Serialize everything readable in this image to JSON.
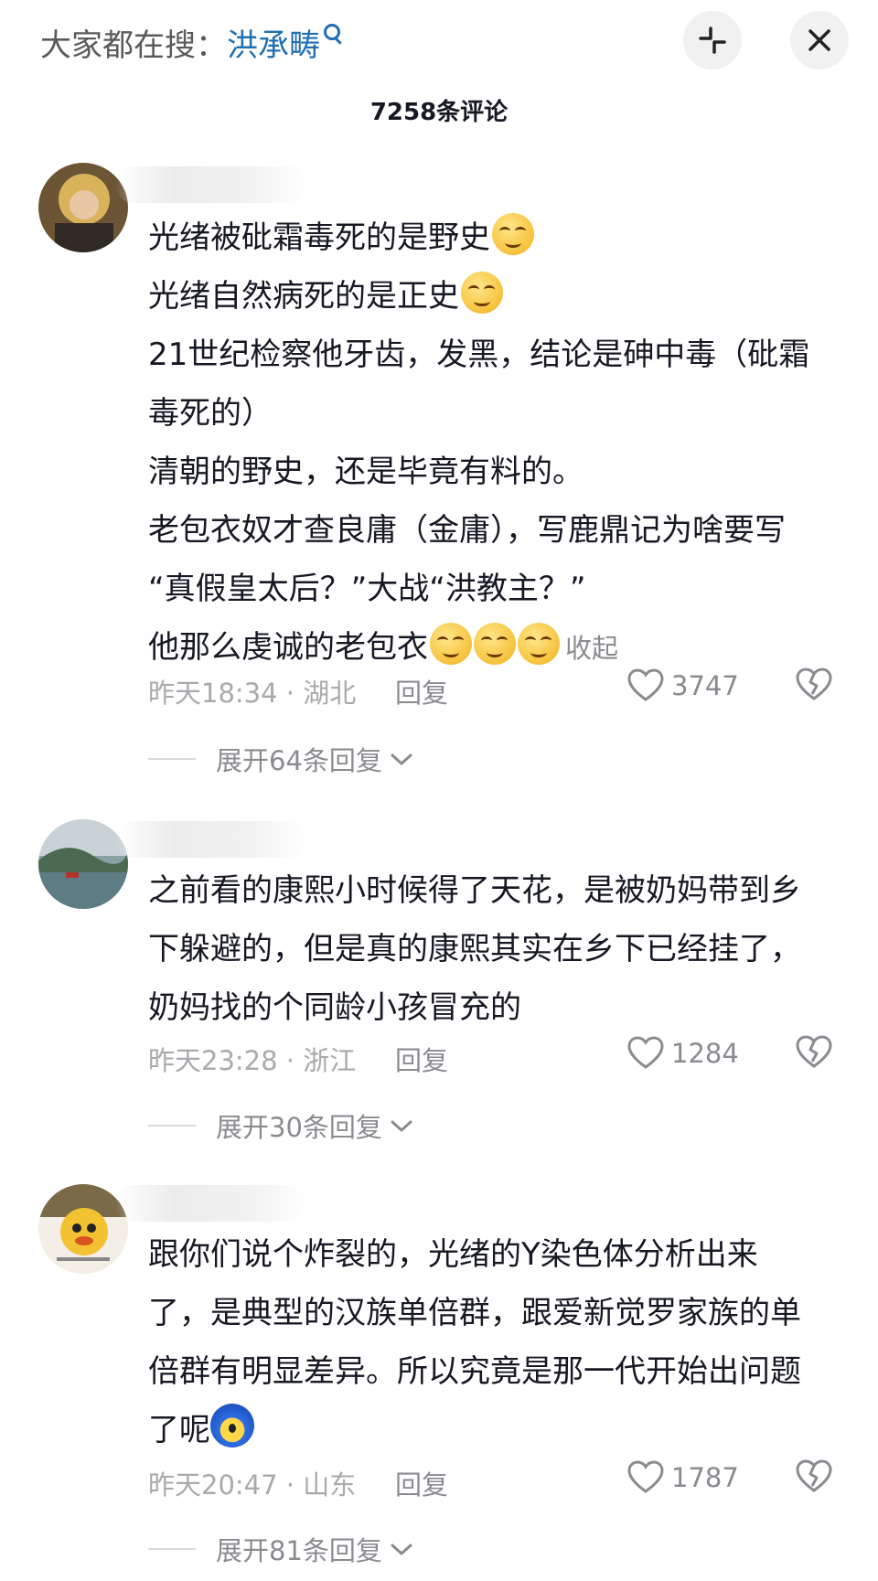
{
  "header": {
    "search_prefix": "大家都在搜：",
    "search_term": "洪承畴",
    "comment_count": "7258条评论"
  },
  "comments": [
    {
      "lines": [
        "光绪被砒霜毒死的是野史",
        "光绪自然病死的是正史",
        "21世纪检察他牙齿，发黑，结论是砷中毒（砒霜",
        "毒死的）",
        "清朝的野史，还是毕竟有料的。",
        "老包衣奴才查良庸（金庸），写鹿鼎记为啥要写",
        "“真假皇太后？”大战“洪教主？”",
        "他那么虔诚的老包衣"
      ],
      "collapse_label": "收起",
      "time_location": "昨天18:34 · 湖北",
      "reply_label": "回复",
      "likes": "3747",
      "expand_label": "展开64条回复"
    },
    {
      "lines": [
        "之前看的康熙小时候得了天花，是被奶妈带到乡",
        "下躲避的，但是真的康熙其实在乡下已经挂了，",
        "奶妈找的个同龄小孩冒充的"
      ],
      "time_location": "昨天23:28 · 浙江",
      "reply_label": "回复",
      "likes": "1284",
      "expand_label": "展开30条回复"
    },
    {
      "lines": [
        "跟你们说个炸裂的，光绪的Y染色体分析出来",
        "了，是典型的汉族单倍群，跟爱新觉罗家族的单",
        "倍群有明显差异。所以究竟是那一代开始出问题",
        "了呢"
      ],
      "time_location": "昨天20:47 · 山东",
      "reply_label": "回复",
      "likes": "1787",
      "expand_label": "展开81条回复"
    }
  ],
  "colors": {
    "accent": "#1f6fb2",
    "muted": "#a9a9ae",
    "text": "#161823"
  },
  "icons": [
    "search-icon",
    "collapse-icon",
    "close-icon",
    "heart-icon",
    "broken-heart-icon",
    "chevron-down-icon",
    "smug-emoji-icon"
  ]
}
